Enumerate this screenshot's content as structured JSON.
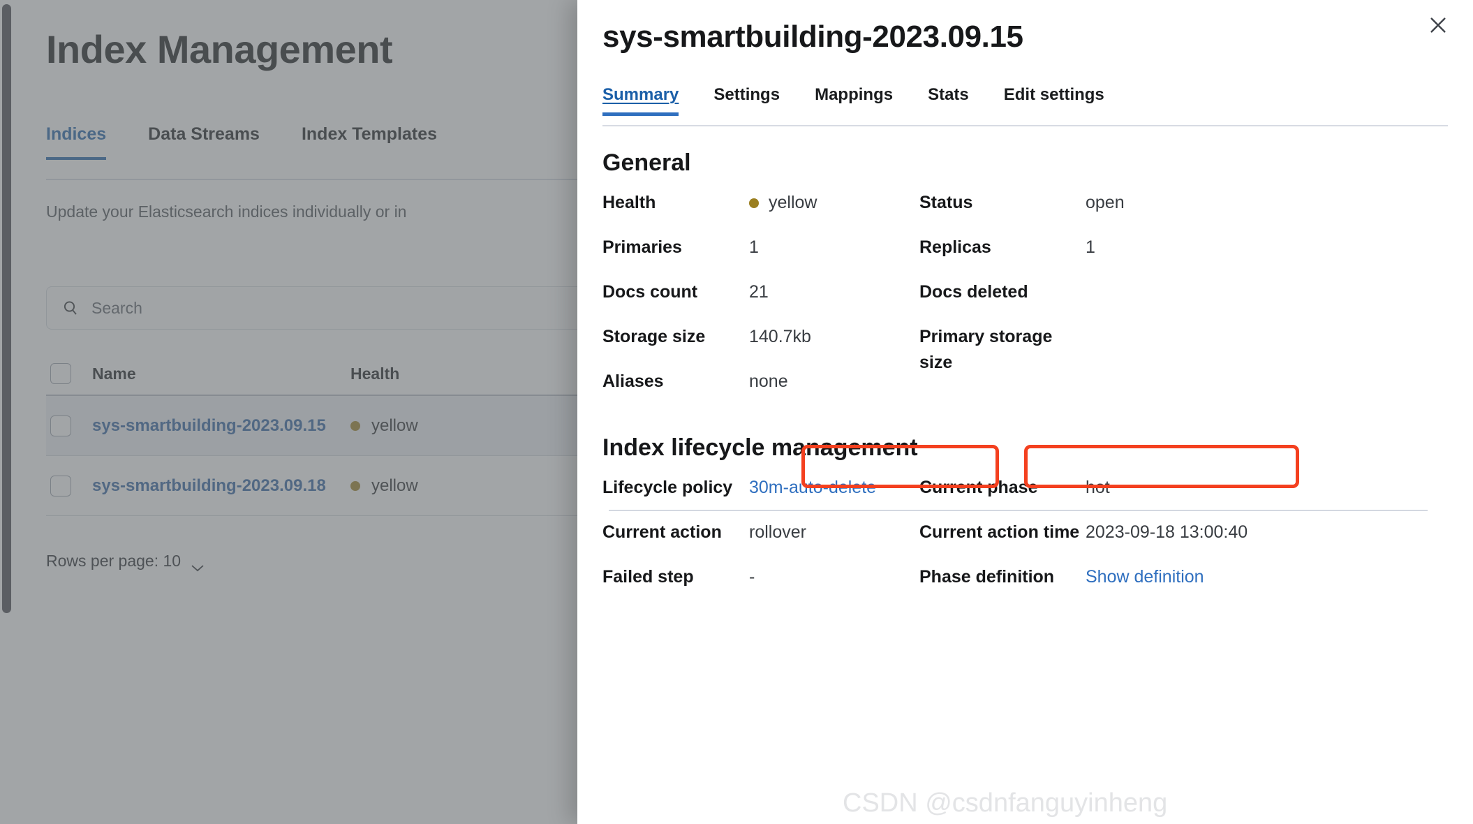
{
  "background_page": {
    "title": "Index Management",
    "tabs": [
      {
        "label": "Indices",
        "active": true
      },
      {
        "label": "Data Streams",
        "active": false
      },
      {
        "label": "Index Templates",
        "active": false
      }
    ],
    "description": "Update your Elasticsearch indices individually or in",
    "search": {
      "placeholder": "Search",
      "value": "",
      "icon": "search-icon"
    },
    "table": {
      "columns": [
        "Name",
        "Health"
      ],
      "rows": [
        {
          "name": "sys-smartbuilding-2023.09.15",
          "health": "yellow",
          "selected": true
        },
        {
          "name": "sys-smartbuilding-2023.09.18",
          "health": "yellow",
          "selected": false
        }
      ]
    },
    "pagination": {
      "rows_per_page_label": "Rows per page: 10",
      "chevron_icon": "chevron-down-icon"
    }
  },
  "flyout": {
    "title": "sys-smartbuilding-2023.09.15",
    "close_icon": "close-icon",
    "tabs": [
      {
        "label": "Summary",
        "active": true
      },
      {
        "label": "Settings",
        "active": false
      },
      {
        "label": "Mappings",
        "active": false
      },
      {
        "label": "Stats",
        "active": false
      },
      {
        "label": "Edit settings",
        "active": false
      }
    ],
    "general": {
      "heading": "General",
      "left": [
        {
          "term": "Health",
          "value": "yellow",
          "has_dot": true
        },
        {
          "term": "Primaries",
          "value": "1"
        },
        {
          "term": "Docs count",
          "value": "21"
        },
        {
          "term": "Storage size",
          "value": "140.7kb"
        },
        {
          "term": "Aliases",
          "value": "none"
        }
      ],
      "right": [
        {
          "term": "Status",
          "value": "open"
        },
        {
          "term": "Replicas",
          "value": "1"
        },
        {
          "term": "Docs deleted",
          "value": ""
        },
        {
          "term": "Primary storage size",
          "value": ""
        }
      ]
    },
    "lifecycle": {
      "heading": "Index lifecycle management",
      "left": [
        {
          "term": "Lifecycle policy",
          "value": "30m-auto-delete",
          "link": true
        },
        {
          "term": "Current action",
          "value": "rollover"
        },
        {
          "term": "Failed step",
          "value": "-"
        }
      ],
      "right": [
        {
          "term": "Current phase",
          "value": "hot"
        },
        {
          "term": "Current action time",
          "value": "2023-09-18 13:00:40"
        },
        {
          "term": "Phase definition",
          "value": "Show definition",
          "link": true
        }
      ]
    }
  },
  "annotations": {
    "highlight_color": "#f4401f",
    "boxes": [
      "lifecycle-policy-highlight",
      "current-phase-highlight"
    ]
  },
  "watermark": "CSDN @csdnfanguyinheng",
  "colors": {
    "accent_blue": "#2f6fbf",
    "link_blue": "#2b5fa0",
    "health_yellow": "#9b7f20",
    "highlight_red": "#f4401f",
    "text_dark": "#17181a"
  }
}
